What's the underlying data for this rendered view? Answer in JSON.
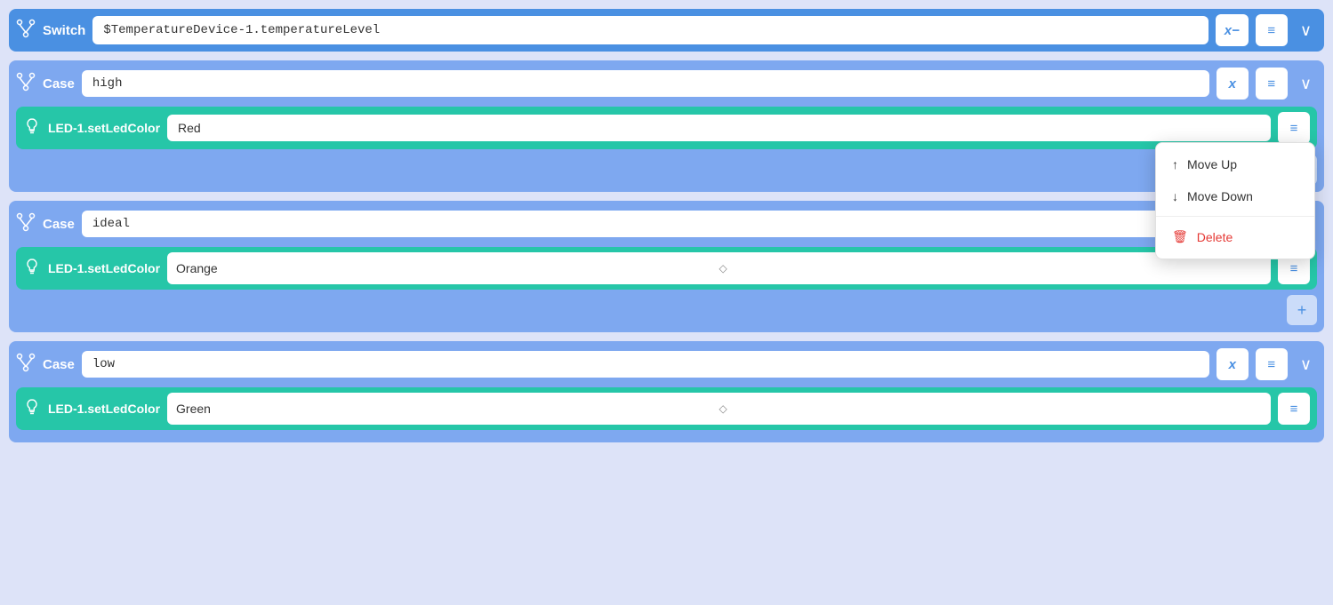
{
  "switch": {
    "icon": "⋱⋰",
    "label": "Switch",
    "value": "$TemperatureDevice-1.temperatureLevel",
    "italic_btn": "x−",
    "lines_btn": "≡",
    "chevron": "∨"
  },
  "cases": [
    {
      "id": "case-high",
      "label": "Case",
      "value": "high",
      "actions": [
        {
          "id": "action-red",
          "icon": "💡",
          "label": "LED-1.setLedColor",
          "value": "Red",
          "has_chevron": false
        }
      ]
    },
    {
      "id": "case-ideal",
      "label": "Case",
      "value": "ideal",
      "actions": [
        {
          "id": "action-orange",
          "icon": "💡",
          "label": "LED-1.setLedColor",
          "value": "Orange",
          "has_chevron": true
        }
      ]
    },
    {
      "id": "case-low",
      "label": "Case",
      "value": "low",
      "actions": [
        {
          "id": "action-green",
          "icon": "💡",
          "label": "LED-1.setLedColor",
          "value": "Green",
          "has_chevron": true
        }
      ]
    }
  ],
  "context_menu": {
    "items": [
      {
        "id": "move-up",
        "icon": "↑",
        "label": "Move Up"
      },
      {
        "id": "move-down",
        "icon": "↓",
        "label": "Move Down"
      },
      {
        "id": "delete",
        "icon": "🗑",
        "label": "Delete",
        "is_delete": true
      }
    ]
  },
  "buttons": {
    "x_italic": "x",
    "x_minus": "x−",
    "lines": "≡",
    "chevron_down": "∨",
    "plus": "+"
  }
}
